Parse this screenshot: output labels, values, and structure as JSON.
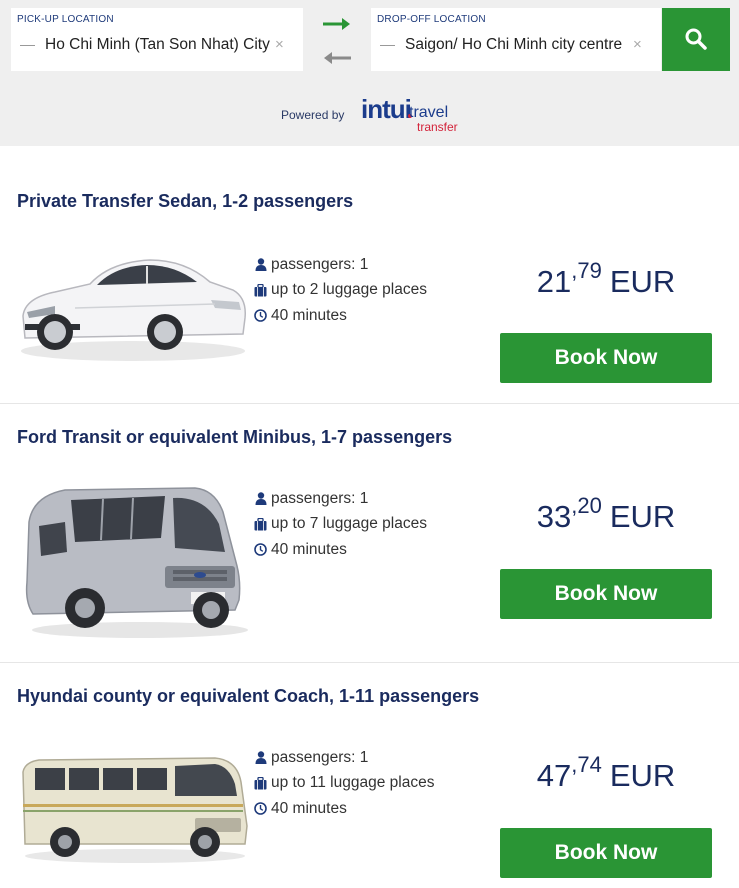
{
  "search": {
    "pickup_label": "PICK-UP LOCATION",
    "pickup_value": "Ho Chi Minh (Tan Son Nhat) City",
    "dropoff_label": "DROP-OFF LOCATION",
    "dropoff_value": "Saigon/ Ho Chi Minh city centre",
    "clear_icon": "×",
    "swap_icon": "swap-arrows-icon",
    "search_icon": "search-icon",
    "accent_color": "#2a9535"
  },
  "powered": {
    "text": "Powered by",
    "logo_main": "intui",
    "logo_travel": "travel",
    "logo_transfer": "transfer"
  },
  "offers": [
    {
      "title": "Private Transfer Sedan, 1-2 passengers",
      "vehicle": "sedan",
      "passengers": "passengers: 1",
      "luggage": "up to 2 luggage places",
      "duration": "40 minutes",
      "price_int": "21",
      "price_sep": ",",
      "price_dec": "79",
      "currency": "EUR",
      "button": "Book Now"
    },
    {
      "title": "Ford Transit or equivalent Minibus, 1-7 passengers",
      "vehicle": "minibus",
      "passengers": "passengers: 1",
      "luggage": "up to 7 luggage places",
      "duration": "40 minutes",
      "price_int": "33",
      "price_sep": ",",
      "price_dec": "20",
      "currency": "EUR",
      "button": "Book Now"
    },
    {
      "title": "Hyundai county or equivalent Coach, 1-11 passengers",
      "vehicle": "coach",
      "passengers": "passengers: 1",
      "luggage": "up to 11 luggage places",
      "duration": "40 minutes",
      "price_int": "47",
      "price_sep": ",",
      "price_dec": "74",
      "currency": "EUR",
      "button": "Book Now"
    }
  ]
}
